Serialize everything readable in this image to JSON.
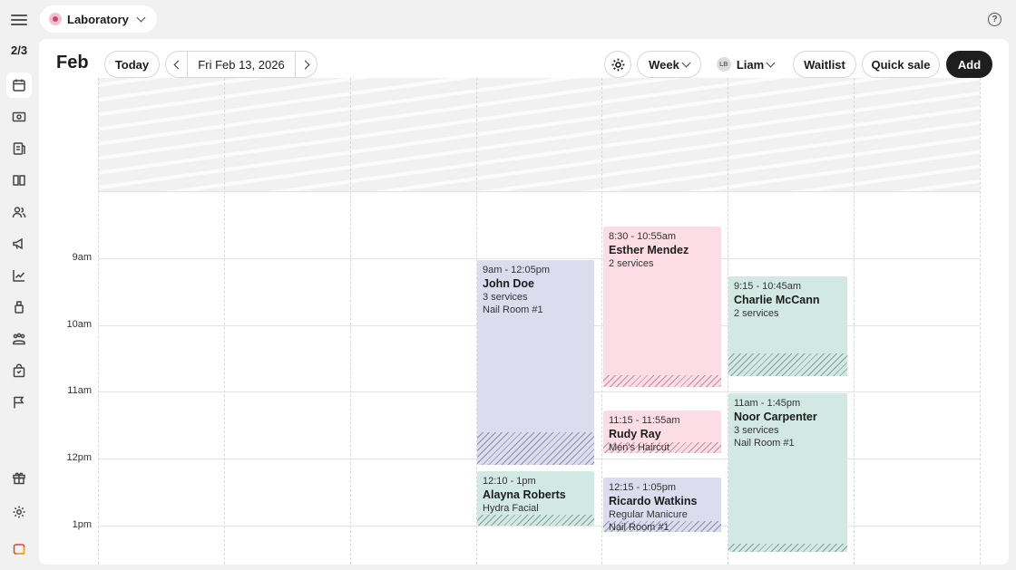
{
  "left_rail": {
    "progress": "2/3",
    "items": [
      {
        "icon": "calendar-icon"
      },
      {
        "icon": "cash-icon"
      },
      {
        "icon": "invoice-icon"
      },
      {
        "icon": "book-icon"
      },
      {
        "icon": "users-icon"
      },
      {
        "icon": "megaphone-icon"
      },
      {
        "icon": "chart-icon"
      },
      {
        "icon": "product-icon"
      },
      {
        "icon": "team-icon"
      },
      {
        "icon": "shopping-bag-icon"
      },
      {
        "icon": "flag-icon"
      },
      {
        "icon": "gift-icon"
      },
      {
        "icon": "settings-icon"
      },
      {
        "icon": "brand-logo-icon"
      }
    ]
  },
  "topbar": {
    "location": "Laboratory",
    "help_icon_text": "?"
  },
  "toolbar": {
    "month": "Feb",
    "today": "Today",
    "date": "Fri Feb 13, 2026",
    "view": "Week",
    "staff_initials": "LB",
    "staff_name": "Liam",
    "waitlist": "Waitlist",
    "quick_sale": "Quick sale",
    "add": "Add"
  },
  "calendar": {
    "hours": [
      "9am",
      "10am",
      "11am",
      "12pm",
      "1pm"
    ],
    "appointments": [
      {
        "time": "9am - 12:05pm",
        "name": "John Doe",
        "lines": [
          "3 services",
          "Nail Room #1"
        ],
        "color": "purple"
      },
      {
        "time": "12:10 - 1pm",
        "name": "Alayna Roberts",
        "lines": [
          "Hydra Facial"
        ],
        "color": "green"
      },
      {
        "time": "8:30 - 10:55am",
        "name": "Esther Mendez",
        "lines": [
          "2 services"
        ],
        "color": "pink"
      },
      {
        "time": "11:15 - 11:55am",
        "name": "Rudy Ray",
        "lines": [
          "Men's Haircut"
        ],
        "color": "pink"
      },
      {
        "time": "12:15 - 1:05pm",
        "name": "Ricardo Watkins",
        "lines": [
          "Regular Manicure",
          "Nail Room #1"
        ],
        "color": "purple"
      },
      {
        "time": "9:15 - 10:45am",
        "name": "Charlie McCann",
        "lines": [
          "2 services"
        ],
        "color": "green"
      },
      {
        "time": "11am - 1:45pm",
        "name": "Noor Carpenter",
        "lines": [
          "3 services",
          "Nail Room #1"
        ],
        "color": "green"
      }
    ]
  },
  "colors": {
    "purple": "#dcdcef",
    "pink": "#fcdde6",
    "green": "#d2e8e2",
    "dark_button": "#1e1e1e"
  }
}
